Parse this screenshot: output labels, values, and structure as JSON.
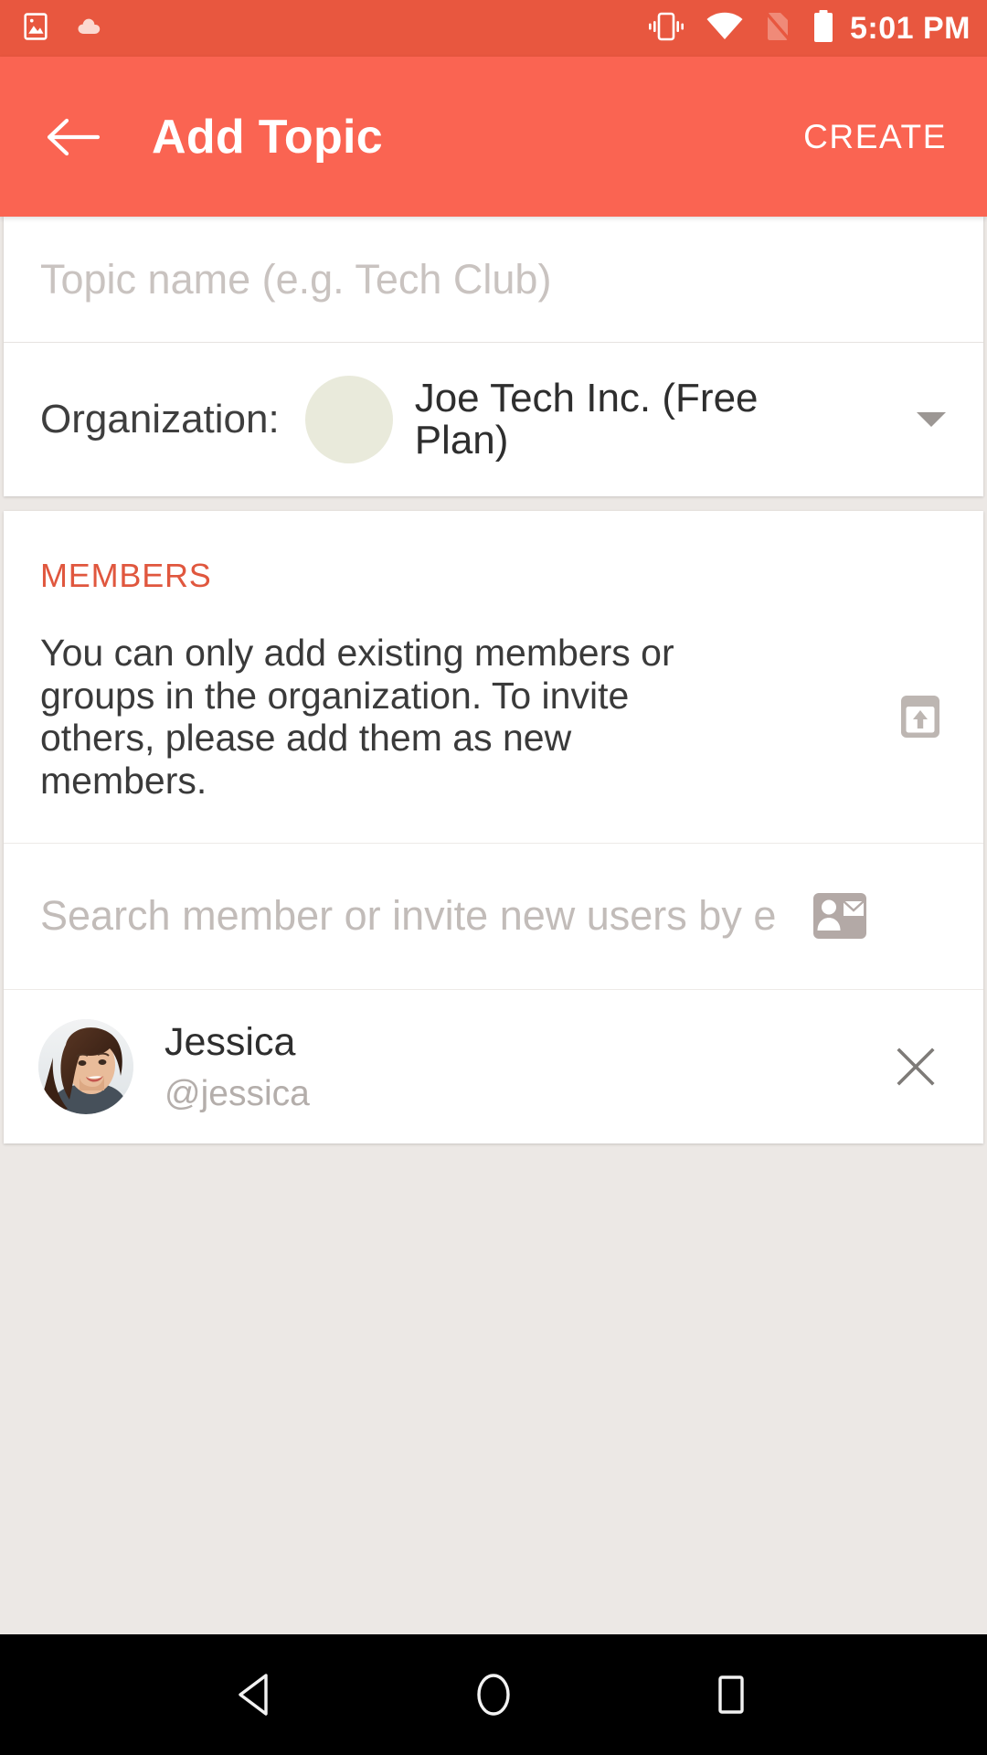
{
  "status_bar": {
    "time": "5:01 PM",
    "icons": [
      {
        "name": "image-icon"
      },
      {
        "name": "cloud-icon"
      },
      {
        "name": "vibrate-icon"
      },
      {
        "name": "wifi-icon"
      },
      {
        "name": "no-sim-icon"
      },
      {
        "name": "battery-full-icon"
      }
    ],
    "background": "#E8573F"
  },
  "app_bar": {
    "back_label": "back-arrow",
    "title": "Add Topic",
    "action_label": "CREATE",
    "background": "#FA6452",
    "text_color": "#FFFFFF"
  },
  "form": {
    "topic_name": {
      "value": "",
      "placeholder": "Topic name (e.g. Tech Club)"
    },
    "organization": {
      "label": "Organization:",
      "value": "Joe Tech Inc. (Free Plan)",
      "avatar_color": "#E9EADB",
      "caret": "chevron-down"
    }
  },
  "members_section": {
    "title": "MEMBERS",
    "title_color": "#E0573E",
    "description": "You can only add existing members or groups in the organization. To invite others, please add them as new members.",
    "import_icon": "import-contacts-icon",
    "search": {
      "value": "",
      "placeholder": "Search member or invite new users by e"
    },
    "members": [
      {
        "name": "Jessica",
        "handle": "@jessica",
        "remove_label": "remove"
      }
    ]
  },
  "nav_bar": {
    "back": "back-triangle",
    "home": "home-circle",
    "recents": "recents-square",
    "background": "#000000"
  }
}
